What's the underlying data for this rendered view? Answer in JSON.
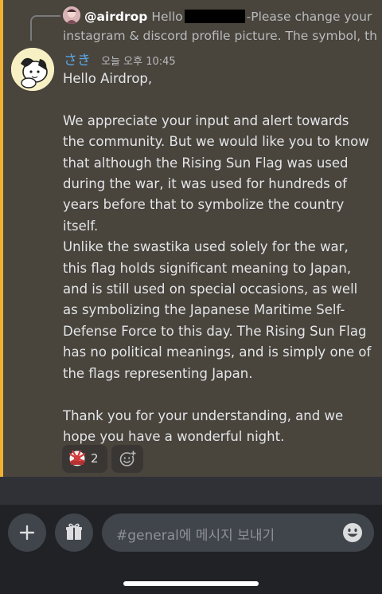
{
  "reply": {
    "mention": "@airdrop",
    "preview_start": "Hello",
    "preview_end": "-Please change your",
    "preview_line2": "instagram & discord profile picture. The symbol, the..."
  },
  "message": {
    "author": "さき",
    "timestamp": "오늘 오후 10:45",
    "body": "Hello Airdrop,\n\nWe appreciate your input and alert towards the community. But we would like you to know that although the Rising Sun Flag was used during the war, it was used for hundreds of years before that to symbolize the country itself.\nUnlike the swastika used solely for the war, this flag holds significant meaning to Japan, and is still used on special occasions, as well as symbolizing the Japanese Maritime Self-Defense Force to this day. The Rising Sun Flag has no political meanings, and is simply one of the flags representing Japan.\n\nThank you for your understanding, and we hope you have a wonderful night."
  },
  "reactions": [
    {
      "icon": "rising-sun-flag-emoji",
      "count": "2"
    }
  ],
  "composer": {
    "placeholder": "#general에 메시지 보내기"
  },
  "colors": {
    "highlight_border": "#f0b132",
    "message_bg": "#49443c",
    "author_color": "#5aa9ea",
    "bottom_bg": "#202225"
  },
  "icons": {
    "plus": "plus-icon",
    "gift": "gift-icon",
    "emoji": "emoji-icon",
    "add_reaction": "add-reaction-icon"
  }
}
